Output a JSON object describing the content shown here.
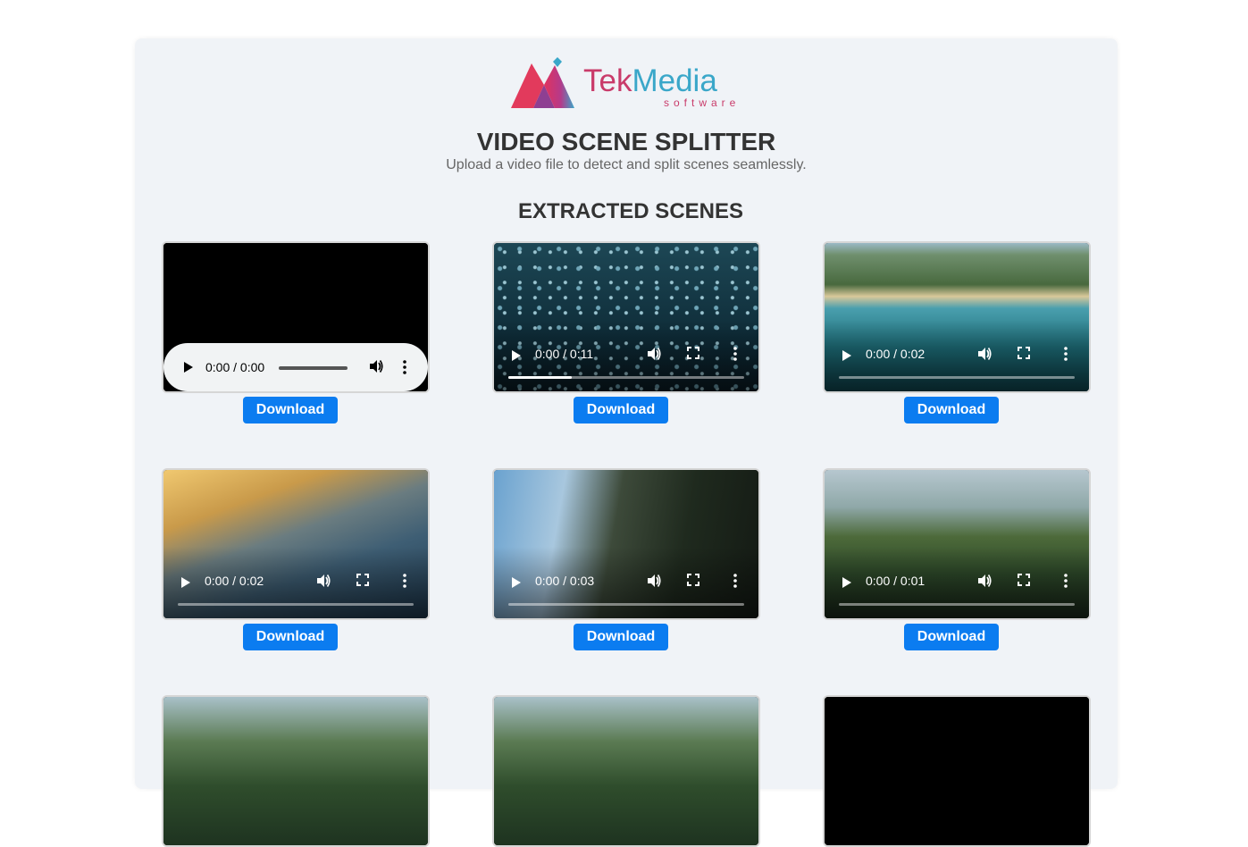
{
  "logo": {
    "brand_part1": "Tek",
    "brand_part2": "Media",
    "tagline": "software"
  },
  "header": {
    "title": "VIDEO SCENE SPLITTER",
    "subtitle": "Upload a video file to detect and split scenes seamlessly."
  },
  "scenes_section": {
    "title": "EXTRACTED SCENES"
  },
  "scenes": [
    {
      "kind": "audio",
      "time": "0:00 / 0:00",
      "download_label": "Download",
      "thumb": "black",
      "progress": 0
    },
    {
      "kind": "video",
      "time": "0:00 / 0:11",
      "download_label": "Download",
      "thumb": "bubbles",
      "progress": 0.27
    },
    {
      "kind": "video",
      "time": "0:00 / 0:02",
      "download_label": "Download",
      "thumb": "coast-aerial",
      "progress": 0
    },
    {
      "kind": "video",
      "time": "0:00 / 0:02",
      "download_label": "Download",
      "thumb": "sunset-beach",
      "progress": 0
    },
    {
      "kind": "video",
      "time": "0:00 / 0:03",
      "download_label": "Download",
      "thumb": "cliffs",
      "progress": 0
    },
    {
      "kind": "video",
      "time": "0:00 / 0:01",
      "download_label": "Download",
      "thumb": "green-peaks",
      "progress": 0
    },
    {
      "kind": "video",
      "time": "",
      "download_label": "",
      "thumb": "valley",
      "progress": 0
    },
    {
      "kind": "video",
      "time": "",
      "download_label": "",
      "thumb": "valley",
      "progress": 0
    },
    {
      "kind": "video",
      "time": "",
      "download_label": "",
      "thumb": "black",
      "progress": 0
    }
  ],
  "colors": {
    "accent": "#0b7cf0",
    "card_bg": "#f0f3f7",
    "brand_pink": "#c93b6a",
    "brand_teal": "#3aa7c9"
  }
}
